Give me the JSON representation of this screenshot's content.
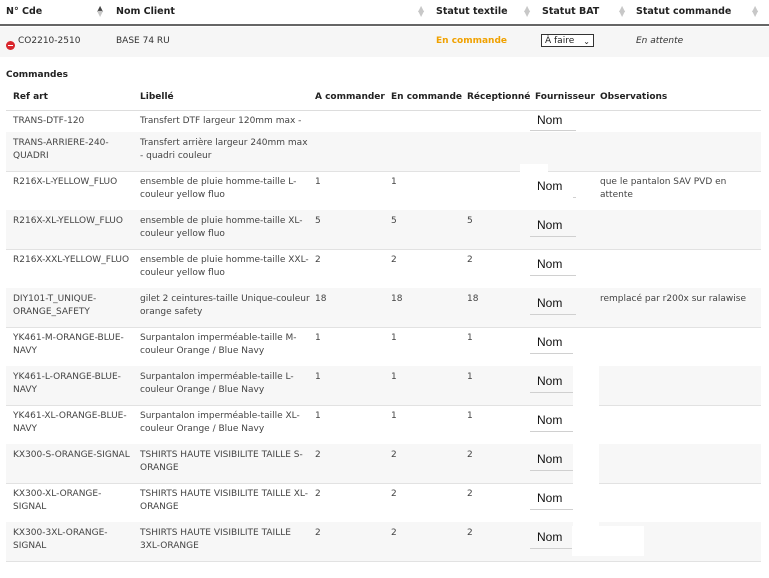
{
  "header": {
    "col_cde": "N° Cde",
    "col_client": "Nom Client",
    "col_textile": "Statut textile",
    "col_bat": "Statut BAT",
    "col_commande": "Statut commande"
  },
  "order": {
    "cde": "CO2210-2510",
    "client": "BASE 74 RU",
    "statut_textile": "En commande",
    "statut_bat": "À faire",
    "statut_commande": "En attente"
  },
  "colors": {
    "textile_accent": "#f0a100",
    "toggle": "#d9272e"
  },
  "sub": {
    "title": "Commandes",
    "columns": {
      "ref": "Ref art",
      "libelle": "Libellé",
      "a_commander": "A commander",
      "en_commande": "En commande",
      "receptionne": "Réceptionné",
      "fournisseur": "Fournisseur",
      "observations": "Observations"
    },
    "rows": [
      {
        "ref": "TRANS-DTF-120",
        "libelle": "Transfert DTF largeur 120mm max -",
        "a": "",
        "e": "",
        "r": "",
        "f": "Nom",
        "o": ""
      },
      {
        "ref": "TRANS-ARRIERE-240-QUADRI",
        "libelle": "Transfert arrière largeur 240mm max - quadri couleur",
        "a": "",
        "e": "",
        "r": "",
        "f": "",
        "o": ""
      },
      {
        "ref": "R216X-L-YELLOW_FLUO",
        "libelle": "ensemble de pluie homme-taille L-couleur yellow fluo",
        "a": "1",
        "e": "1",
        "r": "",
        "f": "Nom",
        "o": "que le pantalon SAV PVD en attente"
      },
      {
        "ref": "R216X-XL-YELLOW_FLUO",
        "libelle": "ensemble de pluie homme-taille XL-couleur yellow fluo",
        "a": "5",
        "e": "5",
        "r": "5",
        "f": "Nom",
        "o": ""
      },
      {
        "ref": "R216X-XXL-YELLOW_FLUO",
        "libelle": "ensemble de pluie homme-taille XXL-couleur yellow fluo",
        "a": "2",
        "e": "2",
        "r": "2",
        "f": "Nom",
        "o": ""
      },
      {
        "ref": "DIY101-T_UNIQUE-ORANGE_SAFETY",
        "libelle": "gilet 2 ceintures-taille Unique-couleur orange safety",
        "a": "18",
        "e": "18",
        "r": "18",
        "f": "Nom",
        "o": "remplacé par r200x sur ralawise"
      },
      {
        "ref": "YK461-M-ORANGE-BLUE-NAVY",
        "libelle": "Surpantalon imperméable-taille M-couleur Orange / Blue Navy",
        "a": "1",
        "e": "1",
        "r": "1",
        "f": "Nom",
        "o": ""
      },
      {
        "ref": "YK461-L-ORANGE-BLUE-NAVY",
        "libelle": "Surpantalon imperméable-taille L-couleur Orange / Blue Navy",
        "a": "1",
        "e": "1",
        "r": "1",
        "f": "Nom",
        "o": ""
      },
      {
        "ref": "YK461-XL-ORANGE-BLUE-NAVY",
        "libelle": "Surpantalon imperméable-taille XL-couleur Orange / Blue Navy",
        "a": "1",
        "e": "1",
        "r": "1",
        "f": "Nom",
        "o": ""
      },
      {
        "ref": "KX300-S-ORANGE-SIGNAL",
        "libelle": "TSHIRTS HAUTE VISIBILITE TAILLE S-ORANGE",
        "a": "2",
        "e": "2",
        "r": "2",
        "f": "Nom",
        "o": ""
      },
      {
        "ref": "KX300-XL-ORANGE-SIGNAL",
        "libelle": "TSHIRTS HAUTE VISIBILITE TAILLE XL-ORANGE",
        "a": "2",
        "e": "2",
        "r": "2",
        "f": "Nom",
        "o": ""
      },
      {
        "ref": "KX300-3XL-ORANGE-SIGNAL",
        "libelle": "TSHIRTS HAUTE VISIBILITE TAILLE 3XL-ORANGE",
        "a": "2",
        "e": "2",
        "r": "2",
        "f": "Nom",
        "o": ""
      }
    ]
  }
}
